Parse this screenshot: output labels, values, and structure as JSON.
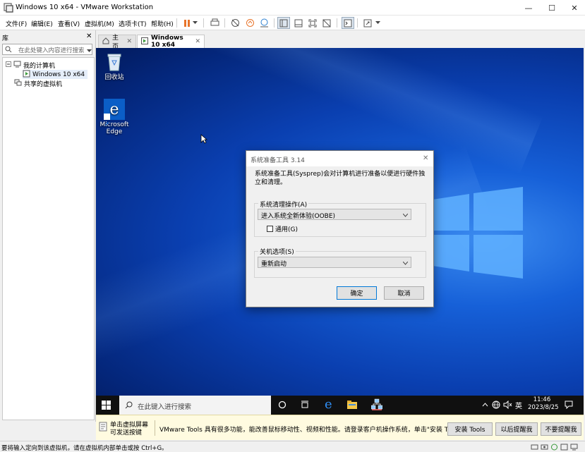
{
  "window": {
    "title": "Windows 10 x64 - VMware Workstation"
  },
  "menu": {
    "items": [
      "文件(F)",
      "编辑(E)",
      "查看(V)",
      "虚拟机(M)",
      "选项卡(T)",
      "帮助(H)"
    ]
  },
  "library": {
    "header": "库",
    "search_placeholder": "在此处键入内容进行搜索",
    "tree": {
      "my_computer": "我的计算机",
      "vm": "Windows 10 x64",
      "shared": "共享的虚拟机"
    }
  },
  "tabs": {
    "home": "主页",
    "vm": "Windows 10 x64"
  },
  "desktop": {
    "recycle_bin": "回收站",
    "edge_line1": "Microsoft",
    "edge_line2": "Edge"
  },
  "dialog": {
    "title": "系统准备工具 3.14",
    "description": "系统准备工具(Sysprep)会对计算机进行准备以便进行硬件独立和清理。",
    "cleanup_group": "系统清理操作(A)",
    "cleanup_value": "进入系统全新体验(OOBE)",
    "generalize_label": "通用(G)",
    "generalize_checked": false,
    "shutdown_group": "关机选项(S)",
    "shutdown_value": "重新启动",
    "ok": "确定",
    "cancel": "取消"
  },
  "taskbar": {
    "search_placeholder": "在此键入进行搜索",
    "ime": "英",
    "time": "11:46",
    "date": "2023/8/25"
  },
  "hint": {
    "click_line1": "单击虚拟屏幕",
    "click_line2": "可发送按键",
    "message": "VMware Tools 具有很多功能，能改善鼠标移动性、视频和性能。请登录客户机操作系统，单击\"安装 Tools\"。",
    "install": "安装 Tools",
    "remind_later": "以后提醒我",
    "never_remind": "不要提醒我"
  },
  "status": {
    "text": "要将输入定向到该虚拟机，请在虚拟机内部单击或按 Ctrl+G。"
  },
  "colors": {
    "accent": "#0078d7",
    "desktop_blue": "#0a3fb0",
    "pause_orange": "#e8742a",
    "hint_bg": "#fffbe0"
  }
}
